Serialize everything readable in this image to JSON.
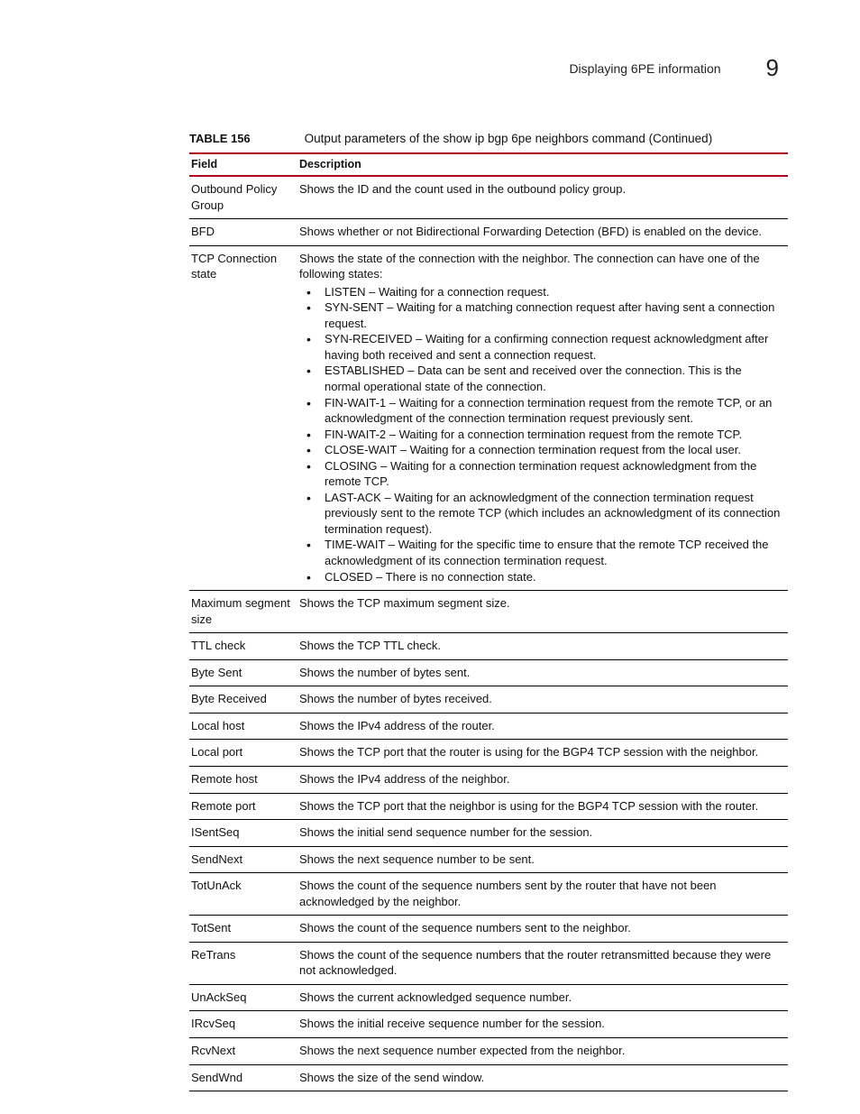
{
  "header": {
    "section": "Displaying 6PE information",
    "chapter": "9"
  },
  "table": {
    "label": "TABLE 156",
    "title": "Output parameters of the show ip bgp 6pe neighbors command  (Continued)",
    "columns": {
      "field": "Field",
      "description": "Description"
    },
    "rows": [
      {
        "field": "Outbound Policy Group",
        "desc": "Shows the ID and the count used in the outbound policy group."
      },
      {
        "field": "BFD",
        "desc": "Shows whether or not Bidirectional Forwarding Detection (BFD) is enabled on the device."
      },
      {
        "field": "TCP Connection state",
        "desc_intro": "Shows the state of the connection with the neighbor. The connection can have one of the following states:",
        "bullets": [
          "LISTEN – Waiting for a connection request.",
          "SYN-SENT – Waiting for a matching connection request after having sent a connection request.",
          "SYN-RECEIVED – Waiting for a confirming connection request acknowledgment after having both received and sent a connection request.",
          "ESTABLISHED – Data can be sent and received over the connection. This is the normal operational state of the connection.",
          "FIN-WAIT-1 – Waiting for a connection termination request from the remote TCP, or an acknowledgment of the connection termination request previously sent.",
          "FIN-WAIT-2 – Waiting for a connection termination request from the remote TCP.",
          "CLOSE-WAIT – Waiting for a connection termination request from the local user.",
          "CLOSING – Waiting for a connection termination request acknowledgment from the remote TCP.",
          "LAST-ACK – Waiting for an acknowledgment of the connection termination request previously sent to the remote TCP (which includes an acknowledgment of its connection termination request).",
          "TIME-WAIT – Waiting for the specific time to ensure that the remote TCP received the acknowledgment of its connection termination request.",
          "CLOSED – There is no connection state."
        ]
      },
      {
        "field": "Maximum segment size",
        "desc": "Shows the TCP maximum segment size."
      },
      {
        "field": "TTL check",
        "desc": "Shows the TCP TTL check."
      },
      {
        "field": "Byte Sent",
        "desc": "Shows the number of bytes sent."
      },
      {
        "field": "Byte Received",
        "desc": "Shows the number of bytes received."
      },
      {
        "field": "Local host",
        "desc": "Shows the IPv4 address of the router."
      },
      {
        "field": "Local port",
        "desc": "Shows the TCP port that the router is using for the BGP4 TCP session with the neighbor."
      },
      {
        "field": "Remote host",
        "desc": "Shows the IPv4 address of the neighbor."
      },
      {
        "field": "Remote port",
        "desc": "Shows the TCP port that the neighbor is using for the BGP4 TCP session with the router."
      },
      {
        "field": "ISentSeq",
        "desc": "Shows the initial send sequence number for the session."
      },
      {
        "field": "SendNext",
        "desc": "Shows the next sequence number to be sent."
      },
      {
        "field": "TotUnAck",
        "desc": "Shows the count of the sequence numbers sent by the router that have not been acknowledged by the neighbor."
      },
      {
        "field": "TotSent",
        "desc": "Shows the count of the sequence numbers sent to the neighbor."
      },
      {
        "field": "ReTrans",
        "desc": "Shows the count of the sequence numbers that the router retransmitted because they were not acknowledged."
      },
      {
        "field": "UnAckSeq",
        "desc": "Shows the current acknowledged sequence number."
      },
      {
        "field": "IRcvSeq",
        "desc": "Shows the initial receive sequence number for the session."
      },
      {
        "field": "RcvNext",
        "desc": "Shows the next sequence number expected from the neighbor."
      },
      {
        "field": "SendWnd",
        "desc": "Shows the size of the send window."
      }
    ]
  }
}
